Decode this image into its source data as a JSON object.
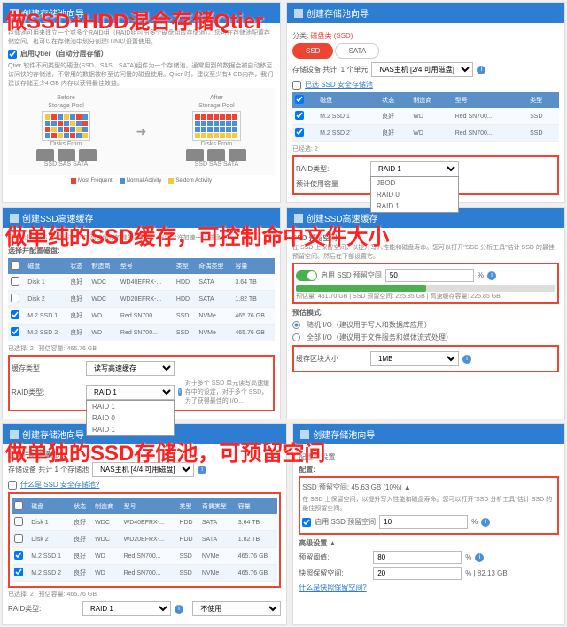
{
  "overlays": {
    "qtier": "做SSD+HDD混合存储Qtier",
    "cache": "做单纯的SSD缓存，可控制命中文件大小",
    "pool": "做单独的SSD存储池，可预留空间"
  },
  "wizard_title": "创建存储池向导",
  "cache_wizard_title": "创建SSD高速缓存",
  "p1": {
    "intro": "存储池可用来建立一个或多个RAID组（RAID组可由多个硬盘组成存储池）。您可在存储池配置存储空间，也可以在存储池中划分创建LUN以设置使用。",
    "qtier_chk": "启用Qtier（自动分层存储）",
    "qtier_desc": "Qtier 软件不同类型的硬盘(SSD、SAS、SATA)组件为一个存储池，通常用到的数据会被自动移至访问快的存储池，不常用的数据被移至访问慢的磁盘使用。Qtier 时，建议至少有4 GB内存，我们建议存储至少4 GB 内存以获得最佳效益。",
    "before": "Before",
    "after": "After",
    "pool_label": "Storage Pool",
    "disks_label": "Disks From",
    "legend": {
      "mf": "Most Frequent",
      "na": "Normal Activity",
      "sa": "Seldom Activity"
    },
    "disks": [
      "SSD",
      "SAS",
      "SATA"
    ]
  },
  "p2": {
    "breadcrumb_a": "分类:",
    "breadcrumb_b": "磁盘类 (SSD)",
    "tabs": {
      "ssd": "SSD",
      "sata": "SATA"
    },
    "sel_label": "存储设备 共计: 1 个单元",
    "host_sel": "NAS主机 [2/4 可用磁盘]",
    "link": "已选 SSD 安全存储池",
    "cols": [
      "",
      "磁盘",
      "状态",
      "制造商",
      "型号",
      "类型"
    ],
    "rows": [
      {
        "chk": true,
        "disk": "M.2 SSD 1",
        "status": "良好",
        "mfr": "WD",
        "model": "Red SN700...",
        "type": "SSD"
      },
      {
        "chk": true,
        "disk": "M.2 SSD 2",
        "status": "良好",
        "mfr": "WD",
        "model": "Red SN700...",
        "type": "SSD"
      }
    ],
    "selcount_label": "已经选:",
    "selcount": "2",
    "raid_label": "RAID类型:",
    "raid_val": "RAID 1",
    "sub_label": "预计使用容量",
    "dd_opts": [
      "JBOD",
      "RAID 0",
      "RAID 1"
    ]
  },
  "p3": {
    "desc": "只能选择 NAS 中或通过 SSD 高速缓存加速的存储池，需要少许加速一个磁盘。",
    "sect": "选择并配置磁盘:",
    "cols": [
      "",
      "磁盘",
      "状态",
      "制造商",
      "型号",
      "类型",
      "奇偶类型",
      "容量"
    ],
    "rows": [
      {
        "chk": false,
        "disk": "Disk 1",
        "status": "良好",
        "mfr": "WDC",
        "model": "WD40EFRX-...",
        "type": "HDD",
        "bus": "SATA",
        "cap": "3.64 TB"
      },
      {
        "chk": false,
        "disk": "Disk 2",
        "status": "良好",
        "mfr": "WDC",
        "model": "WD20EFRX-...",
        "type": "HDD",
        "bus": "SATA",
        "cap": "1.82 TB"
      },
      {
        "chk": true,
        "disk": "M.2 SSD 1",
        "status": "良好",
        "mfr": "WD",
        "model": "Red SN700...",
        "type": "SSD",
        "bus": "NVMe",
        "cap": "465.76 GB"
      },
      {
        "chk": true,
        "disk": "M.2 SSD 2",
        "status": "良好",
        "mfr": "WD",
        "model": "Red SN700...",
        "type": "SSD",
        "bus": "NVMe",
        "cap": "465.76 GB"
      }
    ],
    "selcount": "已选择: 2",
    "estcap": "预估容量: 465.76 GB",
    "cache_type_label": "缓存类型",
    "cache_type_val": "读写高速缓存",
    "raid_label": "RAID类型:",
    "dd_opts": [
      "RAID 1",
      "RAID 0",
      "RAID 1"
    ],
    "hint": "对于多个 SSD 单元读写高速缓存中的设定，对于多个 SSD，为了获得最佳的 I/O..."
  },
  "p4": {
    "sect": "SSD 预留空间:",
    "desc1": "在 SSD 上保留空间，以提升写入性能和磁盘寿命。您可以打开\"SSD 分析工具\"估计 SSD 的最佳预留空间。然后在下部设置它。",
    "toggle_label": "启用 SSD 预留空间",
    "pct": "50",
    "pct_unit": "%",
    "cap_line": "预估量: 451.70 GB  |  SSD 预留空间: 225.85 GB  |  高速缓存容量: 225.85 GB",
    "mode_sect": "预估模式:",
    "opt1": "随机 I/O（建议用于写入和数据库应用）",
    "opt2": "全部 I/O（建议用于文件服务和媒体流式处理）",
    "bytes_label": "缓存区块大小",
    "bytes_val": "1MB"
  },
  "p5": {
    "sect": "选择并配置磁盘:",
    "sel_label": "存储设备 共计 1 个存储池",
    "host": "NAS主机 [4/4 可用磁盘]",
    "link": "什么是 SSD 安全存储池?",
    "cols": [
      "",
      "磁盘",
      "状态",
      "制造商",
      "型号",
      "类型",
      "奇偶类型",
      "容量"
    ],
    "rows": [
      {
        "chk": false,
        "disk": "Disk 1",
        "status": "良好",
        "mfr": "WDC",
        "model": "WD40EFRX-...",
        "type": "HDD",
        "bus": "SATA",
        "cap": "3.64 TB"
      },
      {
        "chk": false,
        "disk": "Disk 2",
        "status": "良好",
        "mfr": "WDC",
        "model": "WD20EFRX-...",
        "type": "HDD",
        "bus": "SATA",
        "cap": "1.82 TB"
      },
      {
        "chk": true,
        "disk": "M.2 SSD 1",
        "status": "良好",
        "mfr": "WD",
        "model": "Red SN700...",
        "type": "SSD",
        "bus": "NVMe",
        "cap": "465.76 GB"
      },
      {
        "chk": true,
        "disk": "M.2 SSD 2",
        "status": "良好",
        "mfr": "WD",
        "model": "Red SN700...",
        "type": "SSD",
        "bus": "NVMe",
        "cap": "465.76 GB"
      }
    ],
    "selcount": "已选择: 2",
    "estcap": "预估容量: 465.76 GB",
    "raid_label": "RAID类型:",
    "raid_val": "RAID 1",
    "unused": "不使用"
  },
  "p6": {
    "breadcrumb": "配置 > 设置",
    "sect": "配置:",
    "cap_line": "SSD 预留空间: 45.63 GB (10%) ▲",
    "desc": "在 SSD 上保留空间，以提升写入性能和磁盘寿命。您可以打开\"SSD 分析工具\"估计 SSD 的最佳预留空间。",
    "toggle_label": "启用 SSD 预留空间",
    "pct": "10",
    "pct_unit": "%",
    "adv": "高级设置 ▲",
    "thresh_label": "预留阈值:",
    "thresh_val": "80",
    "thresh_unit": "%",
    "snap_label": "快照保留空间:",
    "snap_val": "20",
    "snap_unit": "% | 82.13 GB",
    "link": "什么是快照保留空间?"
  }
}
